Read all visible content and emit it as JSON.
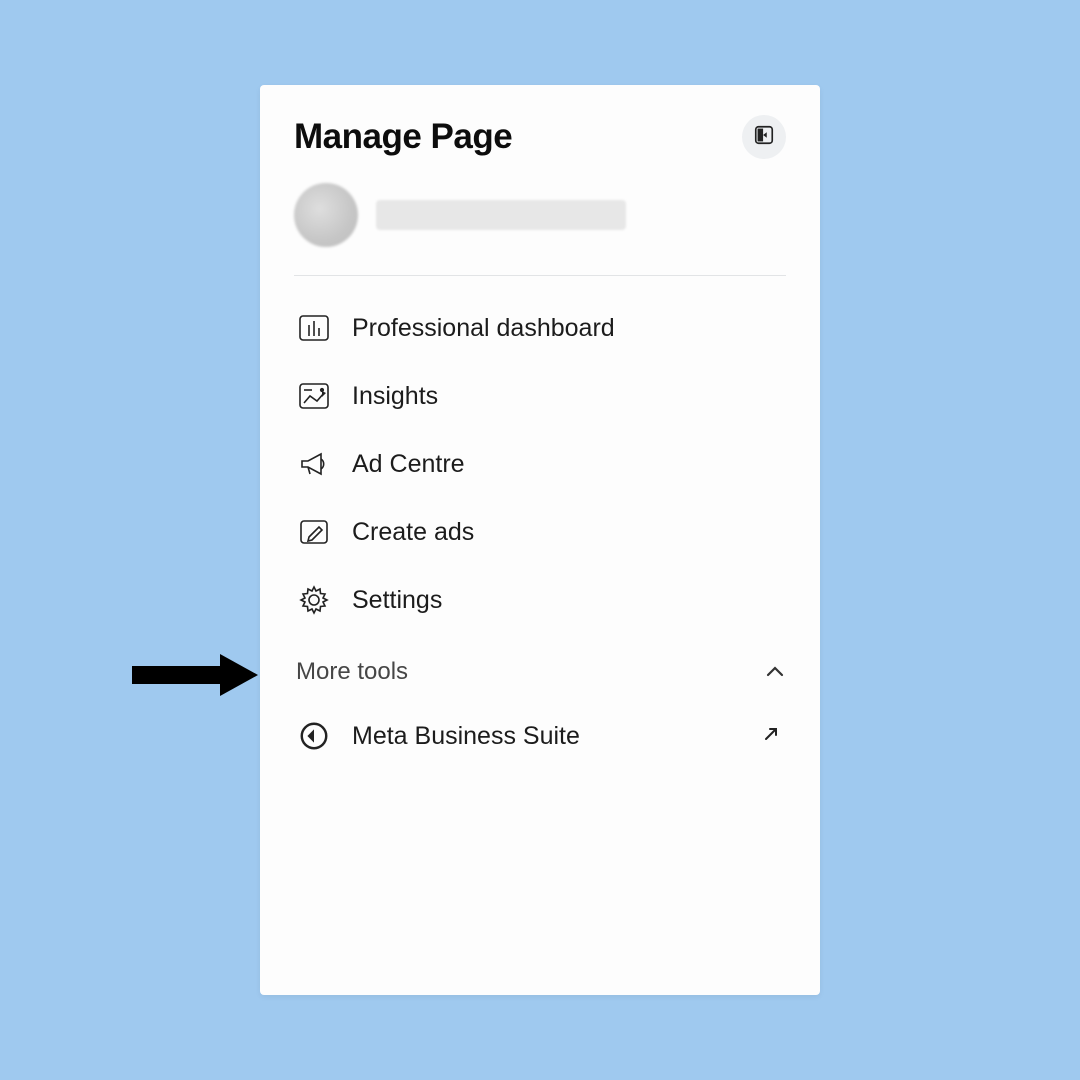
{
  "header": {
    "title": "Manage Page"
  },
  "nav": [
    {
      "icon": "dashboard-icon",
      "label": "Professional dashboard"
    },
    {
      "icon": "insights-icon",
      "label": "Insights"
    },
    {
      "icon": "megaphone-icon",
      "label": "Ad Centre"
    },
    {
      "icon": "pencil-icon",
      "label": "Create ads"
    },
    {
      "icon": "gear-icon",
      "label": "Settings"
    }
  ],
  "more_tools": {
    "title": "More tools",
    "items": [
      {
        "icon": "meta-icon",
        "label": "Meta Business Suite",
        "external": true
      }
    ]
  }
}
